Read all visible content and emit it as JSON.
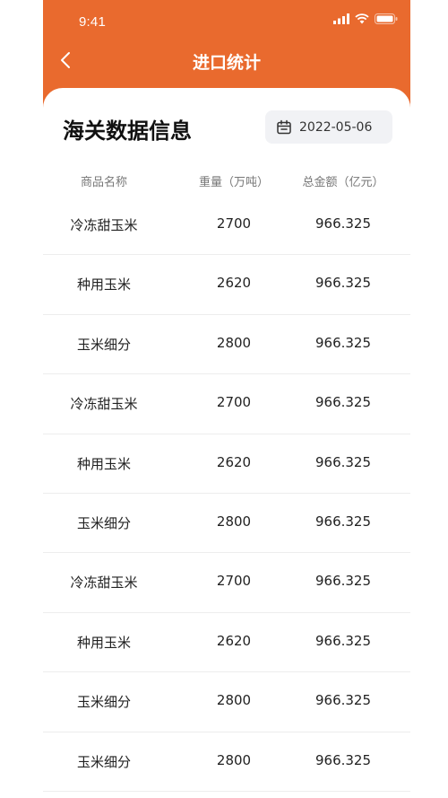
{
  "status": {
    "time": "9:41"
  },
  "nav": {
    "title": "进口统计"
  },
  "page": {
    "title": "海关数据信息",
    "date": "2022-05-06"
  },
  "table": {
    "headers": [
      "商品名称",
      "重量（万吨）",
      "总金额（亿元）"
    ],
    "rows": [
      [
        "冷冻甜玉米",
        "2700",
        "966.325"
      ],
      [
        "种用玉米",
        "2620",
        "966.325"
      ],
      [
        "玉米细分",
        "2800",
        "966.325"
      ],
      [
        "冷冻甜玉米",
        "2700",
        "966.325"
      ],
      [
        "种用玉米",
        "2620",
        "966.325"
      ],
      [
        "玉米细分",
        "2800",
        "966.325"
      ],
      [
        "冷冻甜玉米",
        "2700",
        "966.325"
      ],
      [
        "种用玉米",
        "2620",
        "966.325"
      ],
      [
        "玉米细分",
        "2800",
        "966.325"
      ],
      [
        "玉米细分",
        "2800",
        "966.325"
      ]
    ]
  },
  "colors": {
    "accent": "#E96A2E",
    "chip_bg": "#F1F2F5",
    "divider": "#EDEDED"
  }
}
